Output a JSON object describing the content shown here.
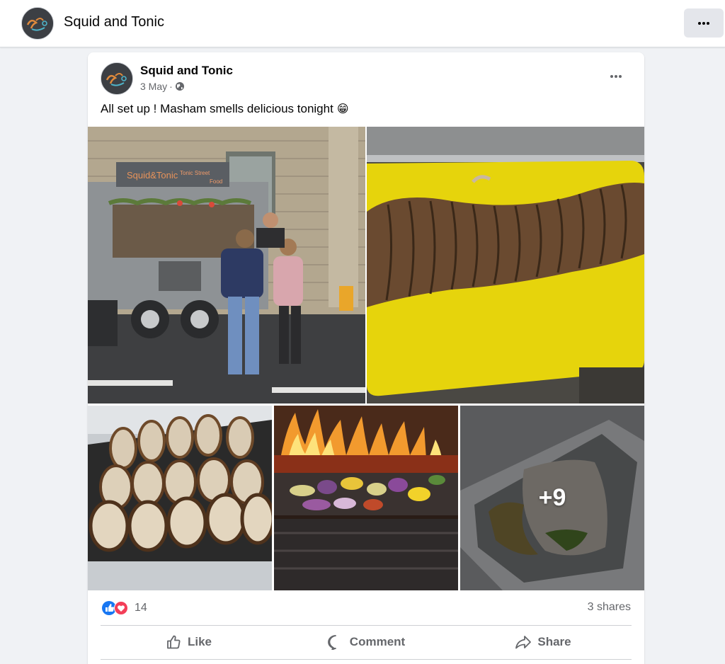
{
  "page": {
    "name": "Squid and Tonic",
    "logo_text": "Squid&Tonic"
  },
  "post": {
    "author": "Squid and Tonic",
    "date": "3 May",
    "separator": "·",
    "text": "All set up ! Masham smells delicious tonight",
    "emoji": "😁",
    "truck_sign": {
      "brand": "Squid&Tonic",
      "line1": "Tonic Street",
      "line2": "Food"
    },
    "photos": [
      {
        "subject": "food-truck-photo"
      },
      {
        "subject": "pork-roll-photo"
      },
      {
        "subject": "sliced-porchetta-photo"
      },
      {
        "subject": "fire-grill-photo"
      },
      {
        "subject": "wrap-box-photo"
      }
    ],
    "more_photos_label": "+9",
    "reaction_count": "14",
    "shares_label": "3 shares",
    "actions": {
      "like": "Like",
      "comment": "Comment",
      "share": "Share"
    }
  },
  "colors": {
    "like_blue": "#1877f2",
    "love_red": "#f33e58",
    "secondary_text": "#65676b",
    "background": "#f0f2f5"
  }
}
